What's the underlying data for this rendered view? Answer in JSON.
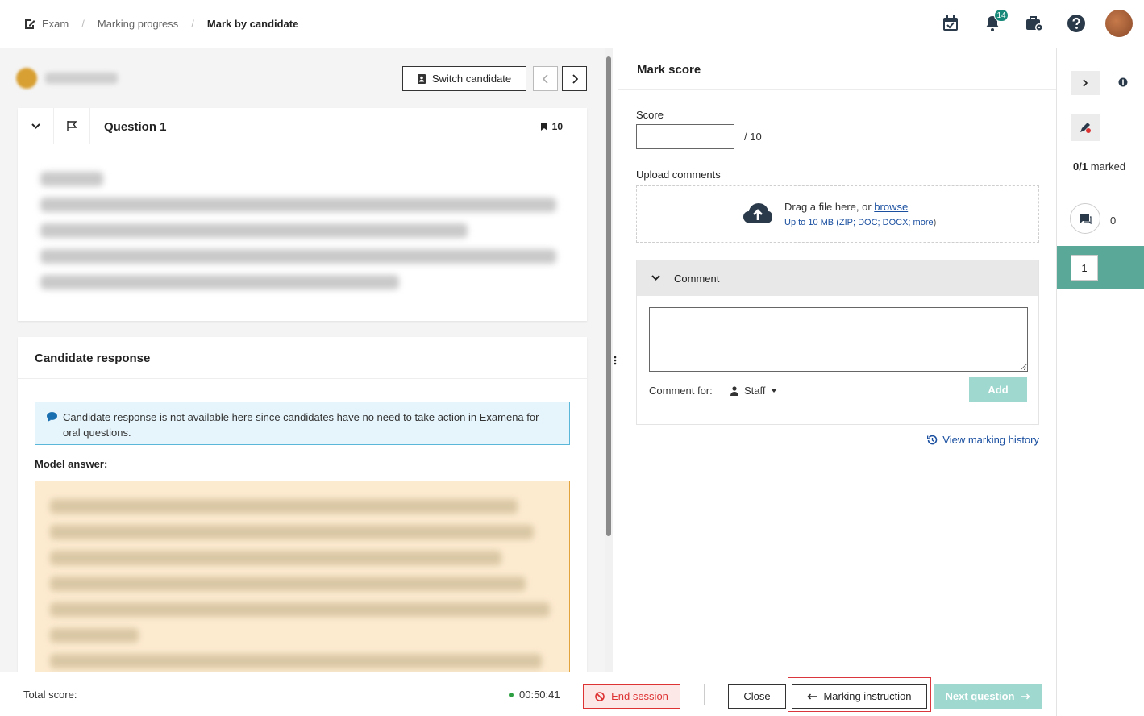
{
  "breadcrumb": {
    "items": [
      "Exam",
      "Marking progress",
      "Mark by candidate"
    ],
    "separator": "/"
  },
  "header": {
    "notification_count": "14"
  },
  "candidate": {
    "switch_label": "Switch candidate"
  },
  "question": {
    "title": "Question 1",
    "marks": "10"
  },
  "response": {
    "title": "Candidate response",
    "info_text": "Candidate response is not available here since candidates have no need to take action in Examena for oral questions.",
    "model_answer_label": "Model answer:"
  },
  "mark_score": {
    "title": "Mark score",
    "score_label": "Score",
    "score_value": "",
    "score_max": "/ 10",
    "upload_label": "Upload comments",
    "upload_text": "Drag a file here, or ",
    "upload_link": "browse",
    "upload_hint": "Up to 10 MB (ZIP; DOC; DOCX;",
    "upload_more": "more",
    "upload_hint_end": ")",
    "comment_header": "Comment",
    "comment_value": "",
    "comment_for_label": "Comment for:",
    "comment_for_value": "Staff",
    "add_label": "Add",
    "history_label": "View marking history"
  },
  "side_panel": {
    "marked_count": "0/1",
    "marked_label": "marked",
    "comment_count": "0",
    "question_numbers": [
      "1"
    ]
  },
  "footer": {
    "total_score_label": "Total score:",
    "timer": "00:50:41",
    "end_session_label": "End session",
    "close_label": "Close",
    "marking_instruction_label": "Marking instruction",
    "next_question_label": "Next question"
  },
  "colors": {
    "accent": "#5aa897",
    "accent_light": "#9fd8cf",
    "danger": "#d33333",
    "link": "#1a4fa0",
    "info_bg": "#e6f5fb",
    "model_bg": "#fdebd0"
  }
}
